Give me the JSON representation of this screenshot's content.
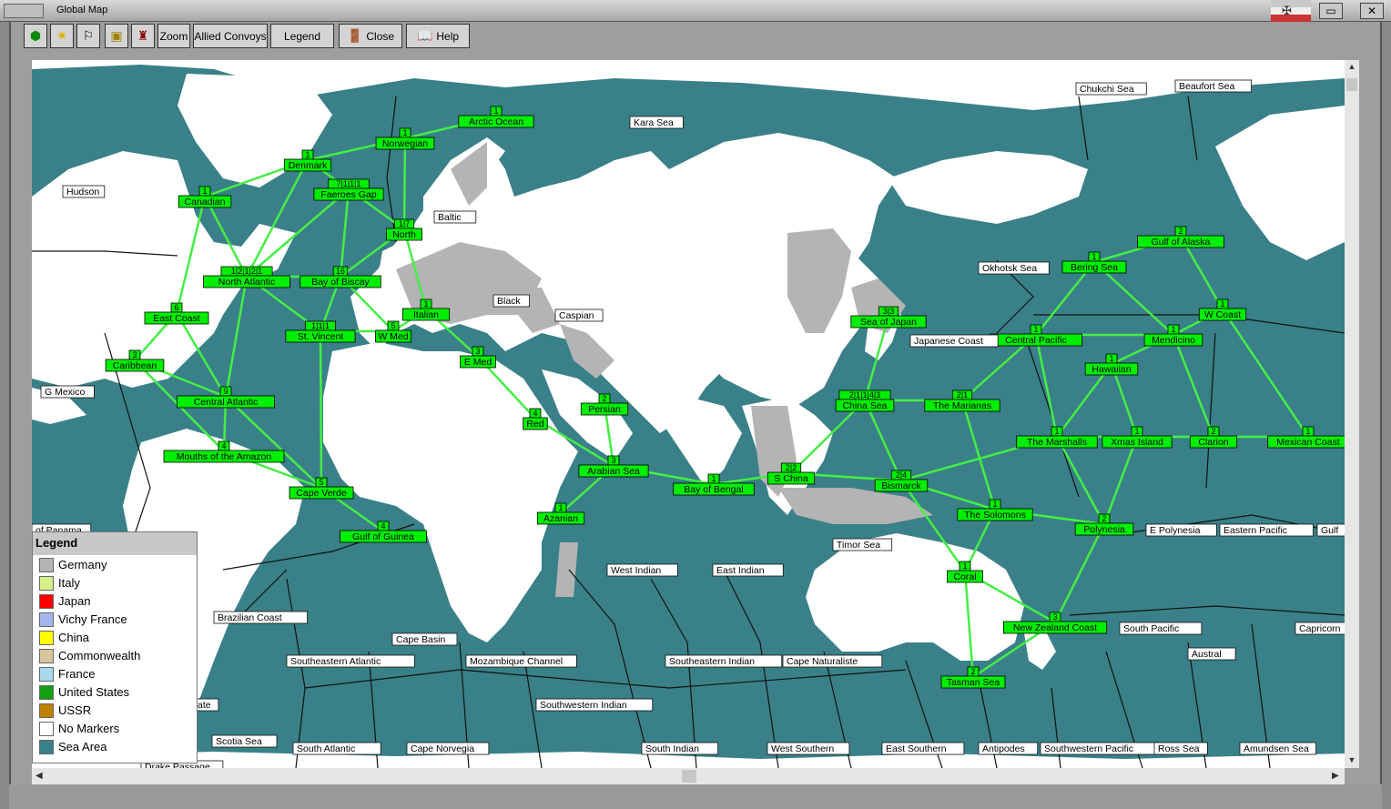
{
  "window": {
    "title": "Global Map"
  },
  "toolbar": {
    "zoom_label": "Zoom",
    "convoys_label": "Allied Convoys",
    "legend_label": "Legend",
    "close_label": "Close",
    "help_label": "Help"
  },
  "legend": {
    "title": "Legend",
    "items": [
      {
        "label": "Germany",
        "color": "#b4b4b4"
      },
      {
        "label": "Italy",
        "color": "#d6f08a"
      },
      {
        "label": "Japan",
        "color": "#ff0000"
      },
      {
        "label": "Vichy France",
        "color": "#a6b4ee"
      },
      {
        "label": "China",
        "color": "#ffff00"
      },
      {
        "label": "Commonwealth",
        "color": "#d7c49a"
      },
      {
        "label": "France",
        "color": "#a6d8ee"
      },
      {
        "label": "United States",
        "color": "#10a010"
      },
      {
        "label": "USSR",
        "color": "#c08000"
      },
      {
        "label": "No Markers",
        "color": "#ffffff"
      },
      {
        "label": "Sea Area",
        "color": "#3a8088"
      }
    ]
  },
  "map": {
    "colors": {
      "sea": "#3a8088",
      "land": "#ffffff",
      "axis": "#b4b4b4",
      "convoy": "#00ee00",
      "convoy_line": "#44ee44"
    },
    "sea_labels": [
      "Chukchi Sea",
      "Beaufort Sea",
      "Kara Sea",
      "Hudson",
      "Baltic",
      "Okhotsk Sea",
      "Black",
      "Caspian",
      "Japanese Coast",
      "G Mexico",
      "of Panama",
      "West Indian",
      "East Indian",
      "Timor Sea",
      "E Polynesia",
      "Eastern Pacific",
      "Gulf",
      "Brazilian Coast",
      "Cape Basin",
      "South Pacific",
      "Capricorn",
      "Southeastern Atlantic",
      "Mozambique Channel",
      "Southeastern Indian",
      "Cape Naturaliste",
      "Austral",
      "Southwestern Indian",
      "ate",
      "Scotia Sea",
      "South Atlantic",
      "Cape Norvegia",
      "South Indian",
      "West Southern",
      "East Southern",
      "Antipodes",
      "Southwestern Pacific",
      "Ross Sea",
      "Amundsen Sea",
      "Drake Passage"
    ],
    "convoy_zones": [
      {
        "name": "Arctic Ocean",
        "count": "1"
      },
      {
        "name": "Norwegian",
        "count": "1"
      },
      {
        "name": "Denmark",
        "count": "1"
      },
      {
        "name": "Faeroes Gap",
        "count": "7|1|1|1"
      },
      {
        "name": "Canadian",
        "count": "1"
      },
      {
        "name": "North",
        "count": "1|7"
      },
      {
        "name": "North Atlantic",
        "count": "1|2|1|2|1"
      },
      {
        "name": "Bay of Biscay",
        "count": "16"
      },
      {
        "name": "Italian",
        "count": "1"
      },
      {
        "name": "East Coast",
        "count": "6"
      },
      {
        "name": "St. Vincent",
        "count": "1|1|1"
      },
      {
        "name": "W Med",
        "count": "5"
      },
      {
        "name": "E Med",
        "count": "3"
      },
      {
        "name": "Caribbean",
        "count": "3"
      },
      {
        "name": "Central Atlantic",
        "count": "9"
      },
      {
        "name": "Persian",
        "count": "2"
      },
      {
        "name": "Red",
        "count": "4"
      },
      {
        "name": "Mouths of the Amazon",
        "count": "4"
      },
      {
        "name": "Arabian Sea",
        "count": "3"
      },
      {
        "name": "Cape Verde",
        "count": "5"
      },
      {
        "name": "Bay of Bengal",
        "count": "1"
      },
      {
        "name": "Azanian",
        "count": "1"
      },
      {
        "name": "Gulf of Guinea",
        "count": "4"
      },
      {
        "name": "Sea of Japan",
        "count": "3|3"
      },
      {
        "name": "China Sea",
        "count": "2|1|1|4|3"
      },
      {
        "name": "S China",
        "count": "2|2"
      },
      {
        "name": "Bismarck",
        "count": "2|4"
      },
      {
        "name": "The Marianas",
        "count": "2|1"
      },
      {
        "name": "Central Pacific",
        "count": "1"
      },
      {
        "name": "Bering Sea",
        "count": "1"
      },
      {
        "name": "Gulf of Alaska",
        "count": "2"
      },
      {
        "name": "W Coast",
        "count": "1"
      },
      {
        "name": "Mendicino",
        "count": "1"
      },
      {
        "name": "Hawaiian",
        "count": "1"
      },
      {
        "name": "The Marshalls",
        "count": "1"
      },
      {
        "name": "Xmas Island",
        "count": "1"
      },
      {
        "name": "Clarion",
        "count": "2"
      },
      {
        "name": "Mexican Coast",
        "count": "1"
      },
      {
        "name": "The Solomons",
        "count": "1"
      },
      {
        "name": "Polynesia",
        "count": "2"
      },
      {
        "name": "Coral",
        "count": "1"
      },
      {
        "name": "New Zealand Coast",
        "count": "3"
      },
      {
        "name": "Tasman Sea",
        "count": "2"
      }
    ]
  }
}
